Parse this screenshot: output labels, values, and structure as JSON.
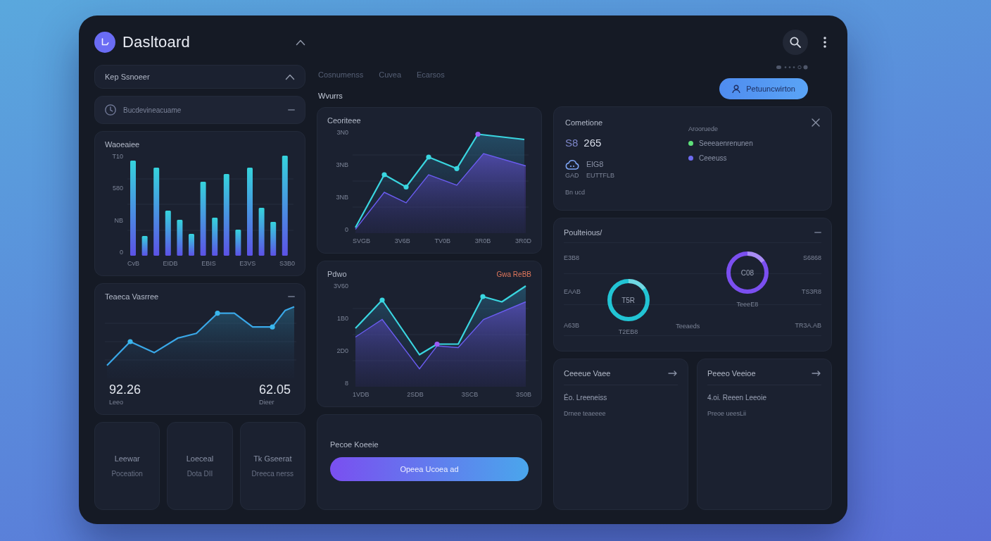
{
  "header": {
    "title": "Dasltoard",
    "action_button": "Petuuncwirton"
  },
  "left": {
    "panel": {
      "title": "Kep Ssnoeer",
      "expanded": true
    },
    "recent": {
      "label": "Bucdevineacuame"
    },
    "bar_card": {
      "title": "Waoeaiee",
      "y_labels": [
        "T10",
        "580",
        "NB",
        "0"
      ],
      "x_labels": [
        "CvB",
        "EIDB",
        "EBIS",
        "E3VS",
        "S3B0"
      ]
    },
    "line_card": {
      "title": "Teaeca Vasrree",
      "stats": [
        {
          "value": "92.26",
          "caption": "Leeo"
        },
        {
          "value": "62.05",
          "caption": "Dieer"
        }
      ]
    },
    "mini_cards": [
      {
        "title": "Leewar",
        "sub": "Poceation"
      },
      {
        "title": "Loeceal",
        "sub": "Dota DII"
      },
      {
        "title": "Tk Gseerat",
        "sub": "Dreeca nerss"
      }
    ]
  },
  "middle": {
    "tabs": [
      {
        "label": "Cosnumenss",
        "selected": false
      },
      {
        "label": "Cuvea",
        "selected": false
      },
      {
        "label": "Ecarsos",
        "selected": false
      }
    ],
    "section_label": "Wvurrs",
    "area_cards": [
      {
        "title": "Ceoriteee",
        "y_labels": [
          "3N0",
          "3NB",
          "3NB",
          "0"
        ],
        "x_labels": [
          "SVGB",
          "3V6B",
          "TV0B",
          "3R0B",
          "3R0D"
        ]
      },
      {
        "title": "Pdwo",
        "badge": "Gwa ReBB",
        "y_labels": [
          "3V60",
          "1B0",
          "2D0",
          "8"
        ],
        "x_labels": [
          "1VDB",
          "2SDB",
          "3SCB",
          "3S0B"
        ]
      }
    ],
    "action_card": {
      "title": "Pecoe Koeeie",
      "button": "Opeea Ucoea ad"
    }
  },
  "right": {
    "summary_card": {
      "title": "Cometione",
      "prefix": "S8",
      "value": "265",
      "metric": "ElG8",
      "metric_caption": "GAD",
      "metric_note": "EUTTFLB",
      "footer": "Bn ucd",
      "legend_title": "Arooruede",
      "legend": [
        {
          "label": "Seeeaenrenunen",
          "color": "#5ee07a"
        },
        {
          "label": "Ceeeuss",
          "color": "#6d6af0"
        }
      ]
    },
    "donut_card": {
      "title": "Poulteious/",
      "left_labels": [
        "E3B8",
        "EAAB",
        "A63B"
      ],
      "right_labels": [
        "S6868",
        "TS3R8",
        "TR3A.AB"
      ],
      "note": "Teeaeds",
      "rings": [
        {
          "value": "T5R",
          "caption": "T2EB8",
          "color": "#22c4d4"
        },
        {
          "value": "C08",
          "caption": "TeeeE8",
          "color": "#7b4ff0"
        }
      ]
    },
    "info_cards": [
      {
        "title": "Ceeeue Vaee",
        "line": "Éo. Lreeneiss",
        "sub": "Drnee teaeeee"
      },
      {
        "title": "Peeeo Veeioe",
        "line": "4.oi. Reeen Leeoie",
        "sub": "Preoe ueesLii"
      }
    ]
  }
}
